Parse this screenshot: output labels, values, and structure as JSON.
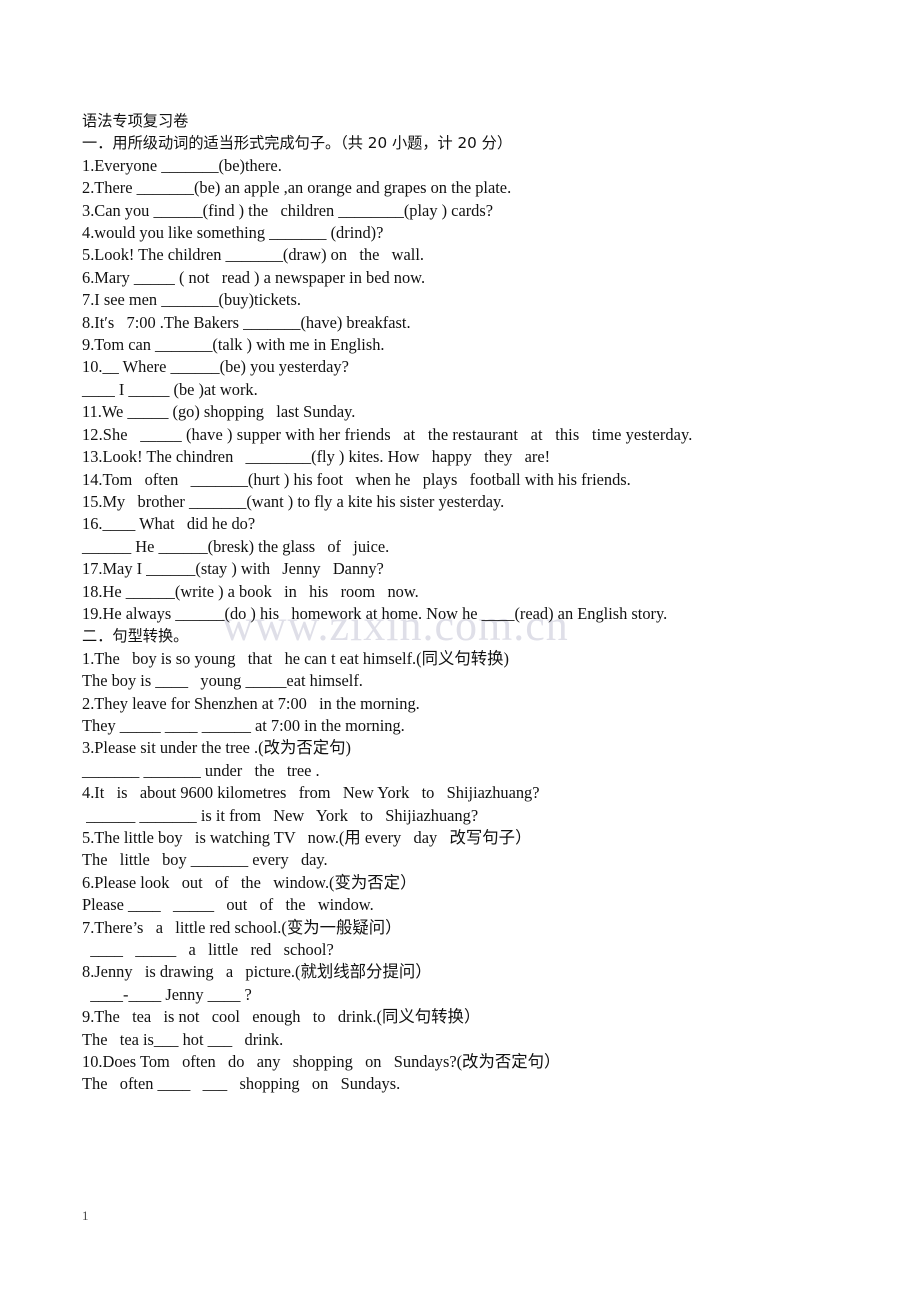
{
  "document": {
    "title": "语法专项复习卷",
    "watermark": "www.zixin.com.cn",
    "page_number": "1",
    "sections": [
      {
        "heading": "一．用所级动词的适当形式完成句子。（共 20 小题，计 20 分）",
        "lines": [
          "1.Everyone _______(be)there.",
          "2.There _______(be) an apple ,an orange and grapes on the plate.",
          "3.Can you ______(find ) the   children ________(play ) cards?",
          "4.would you like something _______ (drind)?",
          "5.Look! The children _______(draw) on   the   wall.",
          "6.Mary _____ ( not   read ) a newspaper in bed now.",
          "7.I see men _______(buy)tickets.",
          "8.It′s   7:00 .The Bakers _______(have) breakfast.",
          "9.Tom can _______(talk ) with me in English.",
          "10.__ Where ______(be) you yesterday?",
          "____ I _____ (be )at work.",
          "11.We _____ (go) shopping   last Sunday.",
          "12.She   _____ (have ) supper with her friends   at   the restaurant   at   this   time yesterday.",
          "13.Look! The chindren   ________(fly ) kites. How   happy   they   are!",
          "14.Tom   often   _______(hurt ) his foot   when he   plays   football with his friends.",
          "15.My   brother _______(want ) to fly a kite his sister yesterday.",
          "16.____ What   did he do?",
          "______ He ______(bresk) the glass   of   juice.",
          "17.May I ______(stay ) with   Jenny   Danny?",
          "18.He ______(write ) a book   in   his   room   now.",
          "19.He always ______(do ) his   homework at home. Now he ____(read) an English story."
        ]
      },
      {
        "heading": "二．句型转换。",
        "lines": [
          "1.The   boy is so young   that   he can t eat himself.(同义句转换)",
          "The boy is ____   young _____eat himself.",
          "2.They leave for Shenzhen at 7:00   in the morning.",
          "They _____ ____ ______ at 7:00 in the morning.",
          "3.Please sit under the tree .(改为否定句)",
          "_______ _______ under   the   tree .",
          "4.It   is   about 9600 kilometres   from   New York   to   Shijiazhuang?",
          " ______ _______ is it from   New   York   to   Shijiazhuang?",
          "5.The little boy   is watching TV   now.(用 every   day   改写句子）",
          "The   little   boy _______ every   day.",
          "6.Please look   out   of   the   window.(变为否定）",
          "Please ____   _____   out   of   the   window.",
          "7.There’s   a   little red school.(变为一般疑问）",
          "  ____   _____   a   little   red   school?",
          "8.Jenny   is drawing   a   picture.(就划线部分提问）",
          "  ____-____ Jenny ____ ?",
          "9.The   tea   is not   cool   enough   to   drink.(同义句转换）",
          "The   tea is___ hot ___   drink.",
          "10.Does Tom   often   do   any   shopping   on   Sundays?(改为否定句）",
          "The   often ____   ___   shopping   on   Sundays."
        ]
      }
    ]
  }
}
